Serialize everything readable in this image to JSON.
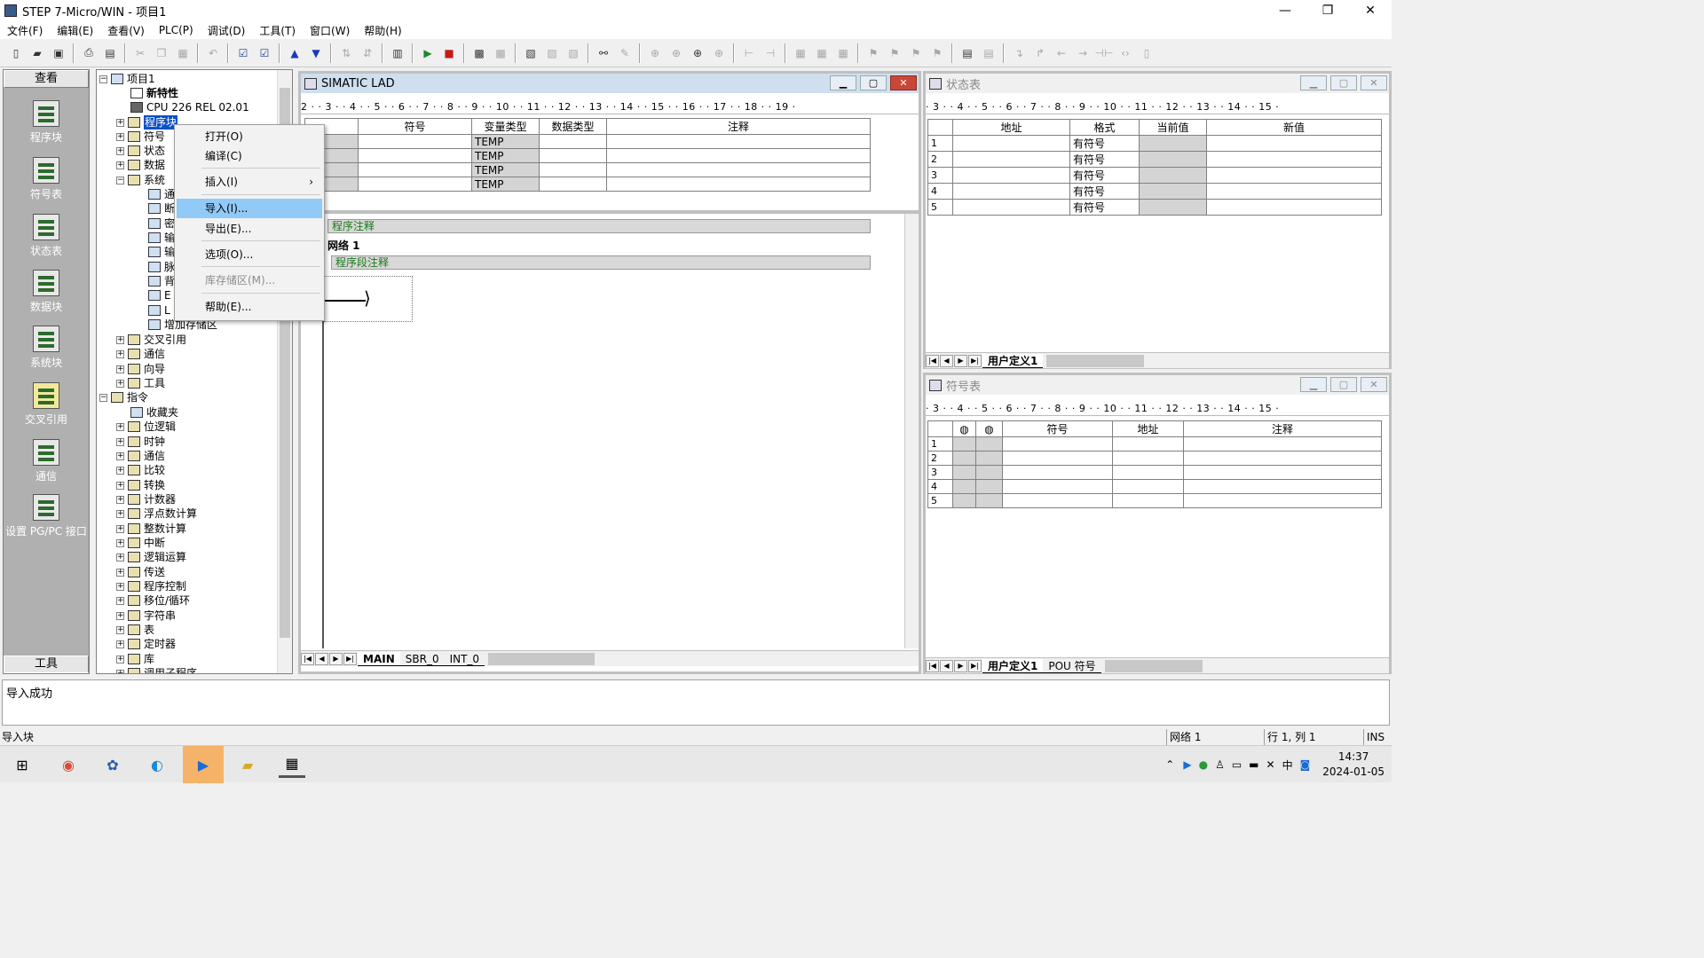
{
  "window": {
    "title": "STEP 7-Micro/WIN - 项目1",
    "minimize": "—",
    "restore": "❐",
    "close": "✕"
  },
  "menu": [
    "文件(F)",
    "编辑(E)",
    "查看(V)",
    "PLC(P)",
    "调试(D)",
    "工具(T)",
    "窗口(W)",
    "帮助(H)"
  ],
  "nav": {
    "header": "查看",
    "footer": "工具",
    "items": [
      "程序块",
      "符号表",
      "状态表",
      "数据块",
      "系统块",
      "交叉引用",
      "通信",
      "设置 PG/PC 接口"
    ]
  },
  "tree": {
    "root": "项目1",
    "new_features": "新特性",
    "cpu": "CPU 226 REL 02.01",
    "program_block": "程序块",
    "symbol": "符号",
    "status": "状态",
    "data": "数据",
    "system": "系统",
    "sub_chars": [
      "通",
      "断",
      "密",
      "输",
      "输",
      "脉",
      "背",
      "E",
      "L"
    ],
    "add_mem": "增加存储区",
    "cross_ref": "交叉引用",
    "comm": "通信",
    "wizard": "向导",
    "tools": "工具",
    "instructions": "指令",
    "instr_items": [
      "收藏夹",
      "位逻辑",
      "时钟",
      "通信",
      "比较",
      "转换",
      "计数器",
      "浮点数计算",
      "整数计算",
      "中断",
      "逻辑运算",
      "传送",
      "程序控制",
      "移位/循环",
      "字符串",
      "表",
      "定时器",
      "库",
      "调用子程序"
    ]
  },
  "context_menu": {
    "open": "打开(O)",
    "compile": "编译(C)",
    "insert": "插入(I)",
    "import": "导入(I)...",
    "export": "导出(E)...",
    "options": "选项(O)...",
    "library_mem": "库存储区(M)...",
    "help": "帮助(E)..."
  },
  "lad": {
    "title": "SIMATIC LAD",
    "ruler": "2 · · 3 · · 4 · · 5 · · 6 · · 7 · · 8 · · 9 · · 10 · · 11 · · 12 · · 13 · · 14 · · 15 · · 16 · · 17 · · 18 · · 19 ·",
    "headers": [
      "符号",
      "变量类型",
      "数据类型",
      "注释"
    ],
    "rows": [
      "TEMP",
      "TEMP",
      "TEMP",
      "TEMP"
    ],
    "program_comment": "程序注释",
    "network": "网络 1",
    "network_comment": "程序段注释",
    "tabs": [
      "MAIN",
      "SBR_0",
      "INT_0"
    ]
  },
  "status_table": {
    "title": "状态表",
    "ruler": "· 3 · · 4 · · 5 · · 6 · · 7 · · 8 · · 9 · · 10 · · 11 · · 12 · · 13 · · 14 · · 15 ·",
    "headers": [
      "地址",
      "格式",
      "当前值",
      "新值"
    ],
    "rows": [
      {
        "n": "1",
        "fmt": "有符号"
      },
      {
        "n": "2",
        "fmt": "有符号"
      },
      {
        "n": "3",
        "fmt": "有符号"
      },
      {
        "n": "4",
        "fmt": "有符号"
      },
      {
        "n": "5",
        "fmt": "有符号"
      }
    ],
    "tab": "用户定义1"
  },
  "symbol_table": {
    "title": "符号表",
    "ruler": "· 3 · · 4 · · 5 · · 6 · · 7 · · 8 · · 9 · · 10 · · 11 · · 12 · · 13 · · 14 · · 15 ·",
    "headers": [
      "符号",
      "地址",
      "注释"
    ],
    "rows": [
      "1",
      "2",
      "3",
      "4",
      "5"
    ],
    "tabs": [
      "用户定义1",
      "POU 符号"
    ]
  },
  "output": "导入成功",
  "statusbar": {
    "left": "导入块",
    "network": "网络 1",
    "position": "行 1, 列 1",
    "mode": "INS"
  },
  "taskbar": {
    "time": "14:37",
    "date": "2024-01-05"
  }
}
